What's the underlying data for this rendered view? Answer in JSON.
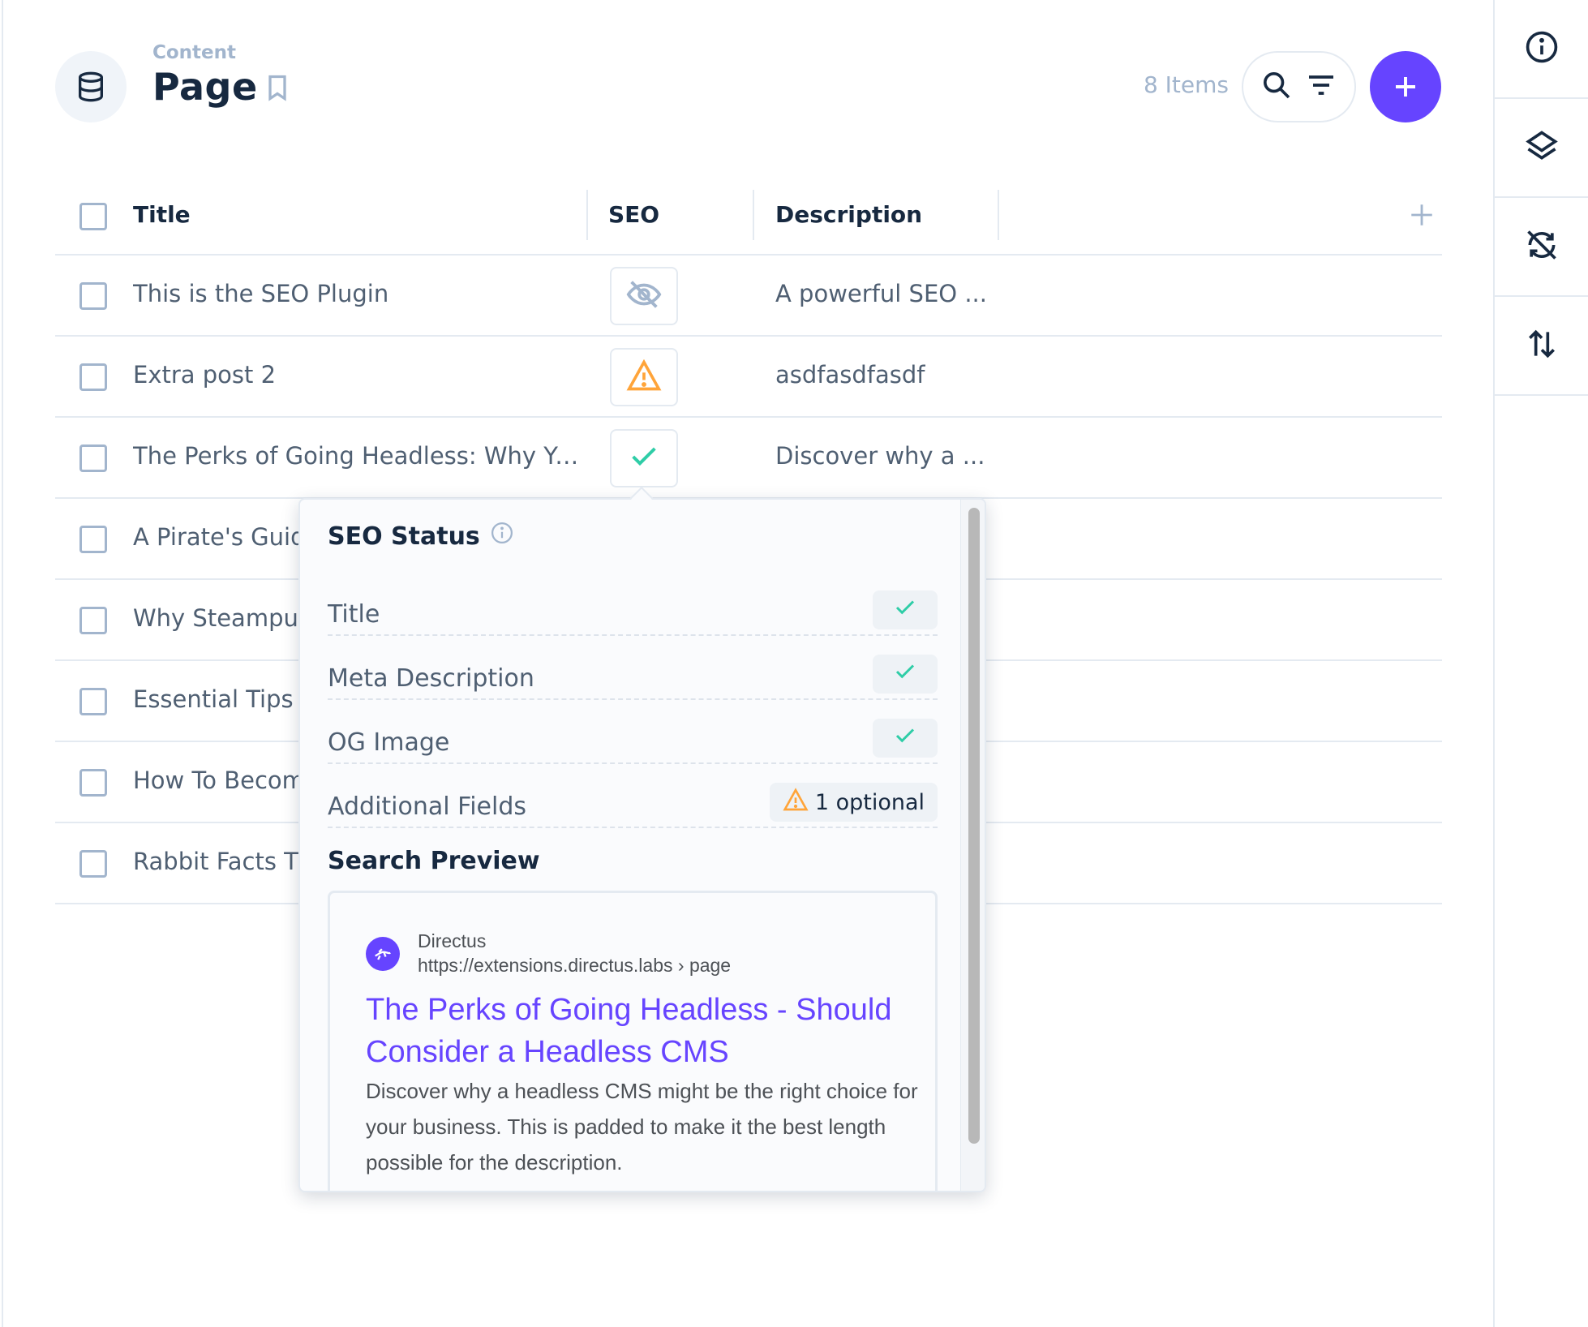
{
  "header": {
    "breadcrumb": "Content",
    "title": "Page",
    "items_count": "8 Items",
    "icon": "database-icon"
  },
  "table": {
    "columns": [
      "Title",
      "SEO",
      "Description"
    ],
    "rows": [
      {
        "title": "This is the SEO Plugin",
        "seo": "hidden",
        "description": "A powerful SEO ..."
      },
      {
        "title": "Extra post 2",
        "seo": "warning",
        "description": "asdfasdfasdf"
      },
      {
        "title": "The Perks of Going Headless: Why Yo...",
        "seo": "ok",
        "description": "Discover why a ..."
      },
      {
        "title": "A Pirate's Guid",
        "seo": "",
        "description": ""
      },
      {
        "title": "Why Steampur",
        "seo": "",
        "description": ""
      },
      {
        "title": "Essential Tips f",
        "seo": "",
        "description": ""
      },
      {
        "title": "How To Becom",
        "seo": "",
        "description": ""
      },
      {
        "title": "Rabbit Facts Tl",
        "seo": "",
        "description": ""
      }
    ]
  },
  "seo_popover": {
    "heading": "SEO Status",
    "checks": [
      {
        "label": "Title",
        "status": "ok"
      },
      {
        "label": "Meta Description",
        "status": "ok"
      },
      {
        "label": "OG Image",
        "status": "ok"
      },
      {
        "label": "Additional Fields",
        "status": "warning",
        "badge": "1 optional"
      }
    ],
    "search_preview_heading": "Search Preview",
    "preview": {
      "site_name": "Directus",
      "url": "https://extensions.directus.labs › page",
      "title": "The Perks of Going Headless - Should Consider a Headless CMS",
      "description": "Discover why a headless CMS might be the right choice for your business. This is padded to make it the best length possible for the description."
    }
  },
  "colors": {
    "accent": "#6644ff",
    "success": "#2ecda7",
    "warning": "#ffa439",
    "muted": "#a2b5cd",
    "text": "#172940"
  },
  "sidebar_icons": [
    "info-icon",
    "layers-icon",
    "sync-disabled-icon",
    "sort-icon"
  ]
}
